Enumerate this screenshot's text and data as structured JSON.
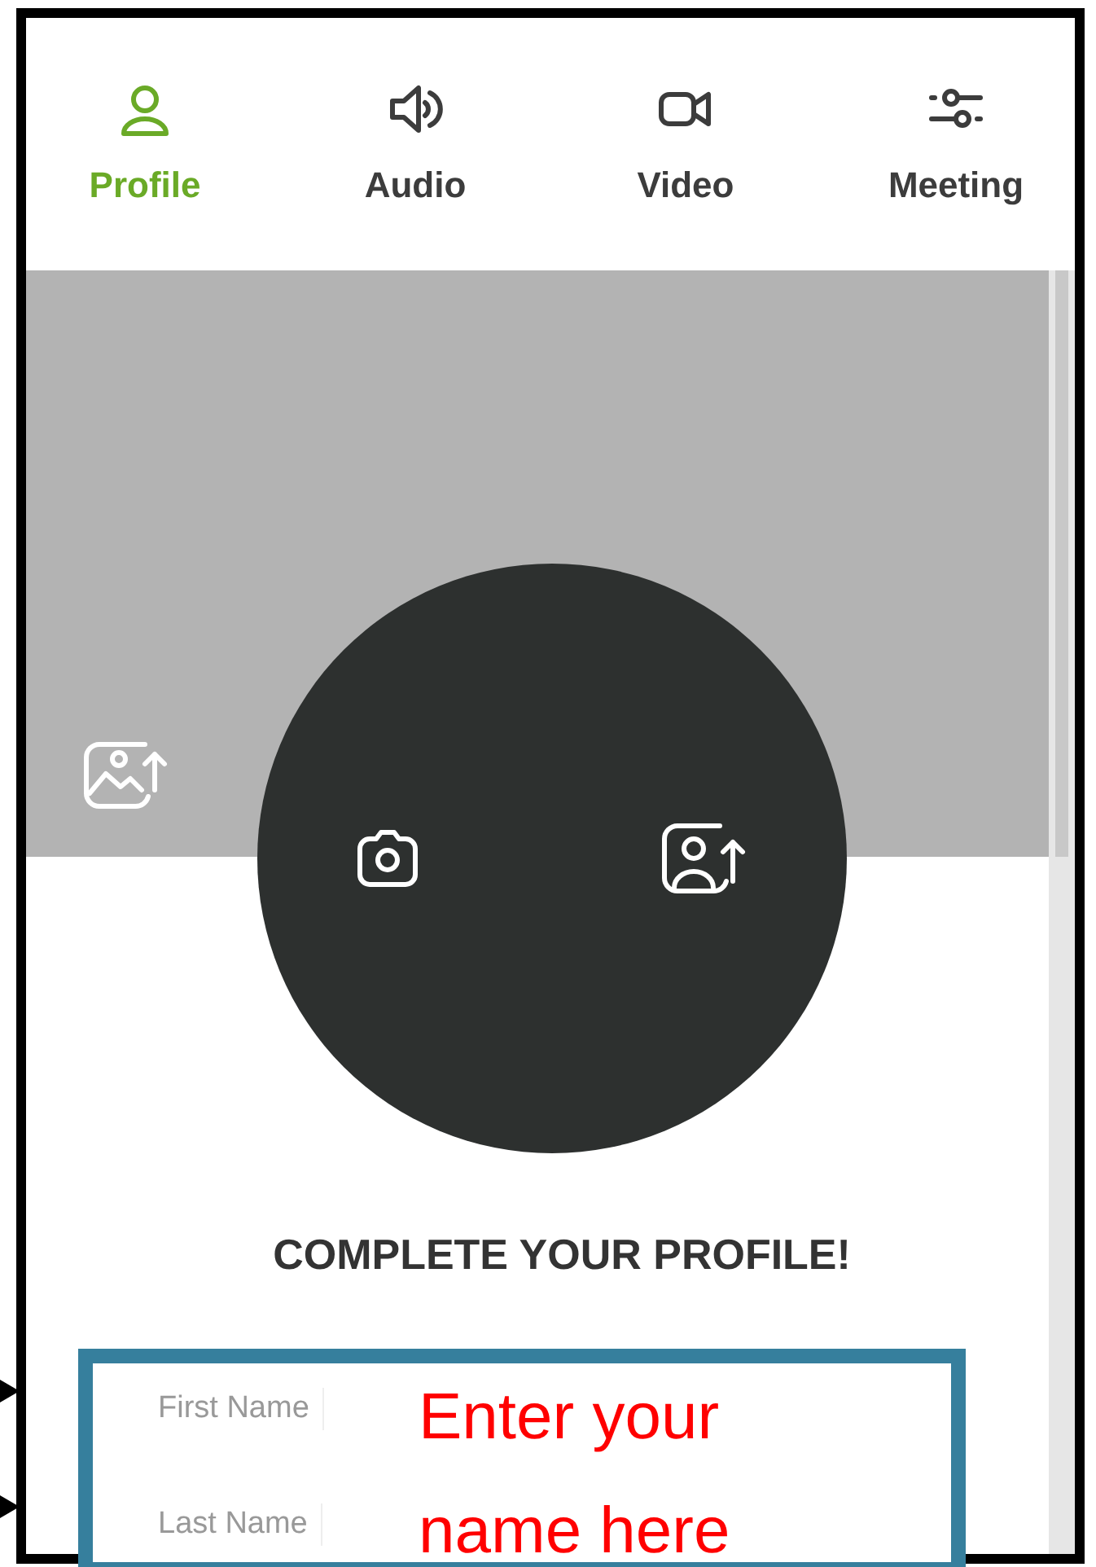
{
  "tabs": [
    {
      "label": "Profile",
      "kind": "person",
      "selected": true
    },
    {
      "label": "Audio",
      "kind": "speaker",
      "selected": false
    },
    {
      "label": "Video",
      "kind": "camera",
      "selected": false
    },
    {
      "label": "Meeting",
      "kind": "sliders",
      "selected": false
    }
  ],
  "heading": "COMPLETE YOUR PROFILE!",
  "fields": [
    {
      "label": "First Name"
    },
    {
      "label": "Last Name"
    }
  ],
  "annotation": {
    "text": "Enter your name here",
    "color": "#ff0000"
  }
}
